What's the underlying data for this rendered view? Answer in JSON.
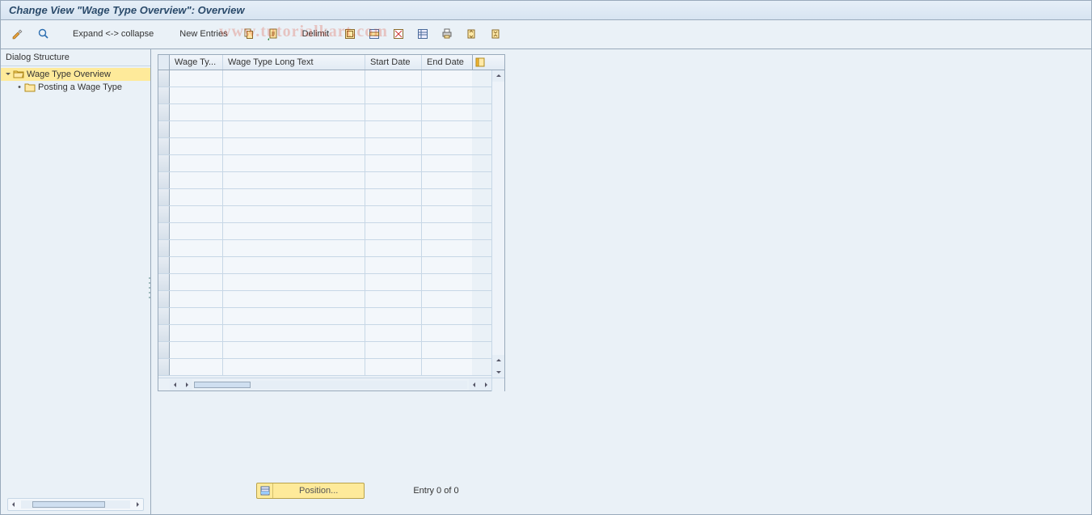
{
  "title": "Change View \"Wage Type Overview\": Overview",
  "toolbar": {
    "expand_collapse": "Expand <-> collapse",
    "new_entries": "New Entries",
    "delimit": "Delimit"
  },
  "tree": {
    "title": "Dialog Structure",
    "items": [
      {
        "label": "Wage Type Overview",
        "icon": "folder-open",
        "selected": true,
        "level": 0,
        "caret": "down"
      },
      {
        "label": "Posting a Wage Type",
        "icon": "folder",
        "selected": false,
        "level": 1,
        "caret": "none"
      }
    ]
  },
  "grid": {
    "columns": {
      "wage_type": "Wage Ty...",
      "wage_type_long_text": "Wage Type Long Text",
      "start_date": "Start Date",
      "end_date": "End Date"
    },
    "row_count": 18
  },
  "position_button": "Position...",
  "entry_status": "Entry 0 of 0",
  "watermark": "www.tutorialkart.com"
}
